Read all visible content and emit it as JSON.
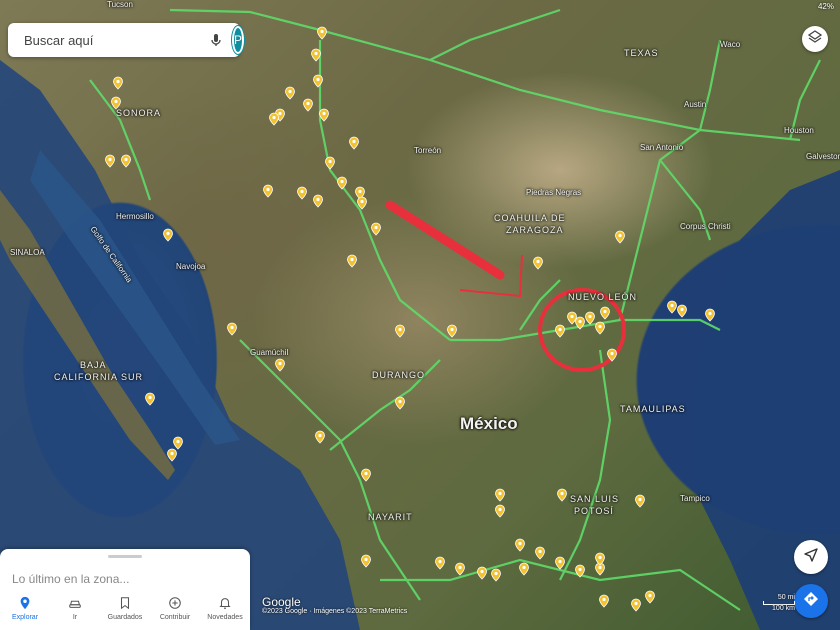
{
  "status": {
    "battery": "42%"
  },
  "search": {
    "placeholder": "Buscar aquí",
    "avatar_letter": "P"
  },
  "map": {
    "labels": {
      "tucson": "Tucson",
      "sonora": "SONORA",
      "texas": "TEXAS",
      "austin": "Austin",
      "houston": "Houston",
      "galveston": "Galveston",
      "san_antonio": "San Antonio",
      "piedras_negras": "Piedras Negras",
      "corpus_christi": "Corpus Christi",
      "coahuila": "COAHUILA DE",
      "zaragoza": "ZARAGOZA",
      "nuevo_leon": "NUEVO LEÓN",
      "tamaulipas": "TAMAULIPAS",
      "durango": "DURANGO",
      "mexico": "México",
      "baja_california_sur_1": "BAJA",
      "baja_california_sur_2": "CALIFORNIA SUR",
      "golfo": "Golfo de California",
      "nayarit": "NAYARIT",
      "san_luis_1": "SAN LUIS",
      "san_luis_2": "POTOSÍ",
      "tampico": "Tampico",
      "navojoa": "Navojoa",
      "guamuchil": "Guamúchil",
      "hermosillo": "Hermosillo",
      "torreon": "Torreón",
      "waco": "Waco",
      "sinaloa": "SINALOA"
    }
  },
  "attribution": {
    "logo": "Google",
    "text": "©2023 Google · Imágenes ©2023 TerraMetrics"
  },
  "scale": {
    "miles": "50 mi",
    "km": "100 km"
  },
  "panel": {
    "title": "Lo último en la zona...",
    "tabs": [
      {
        "label": "Explorar"
      },
      {
        "label": "Ir"
      },
      {
        "label": "Guardados"
      },
      {
        "label": "Contribuir"
      },
      {
        "label": "Novedades"
      }
    ]
  },
  "colors": {
    "road": "#5fdc6a",
    "pin": "#f2c230",
    "accent": "#1a73e8",
    "annotation": "#e8303c"
  }
}
